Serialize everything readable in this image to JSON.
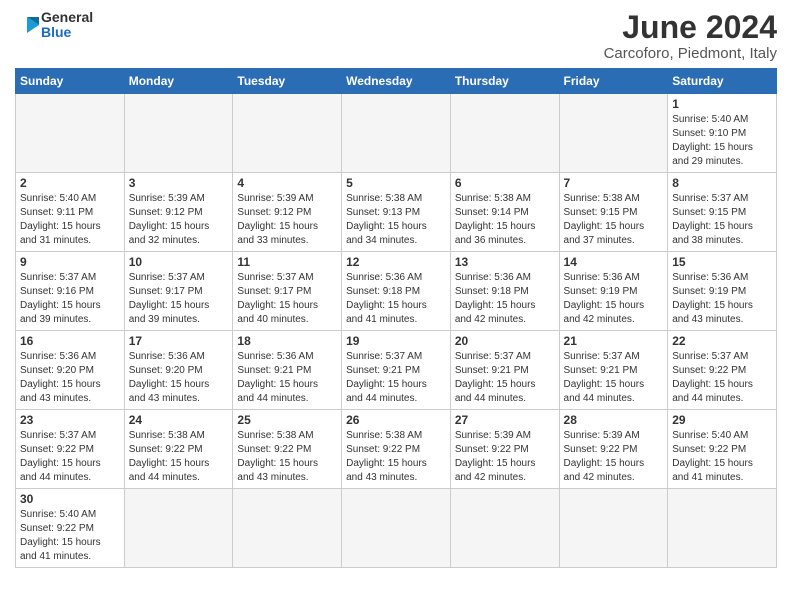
{
  "logo": {
    "line1": "General",
    "line2": "Blue"
  },
  "title": "June 2024",
  "location": "Carcoforo, Piedmont, Italy",
  "weekdays": [
    "Sunday",
    "Monday",
    "Tuesday",
    "Wednesday",
    "Thursday",
    "Friday",
    "Saturday"
  ],
  "weeks": [
    [
      {
        "day": "",
        "info": ""
      },
      {
        "day": "",
        "info": ""
      },
      {
        "day": "",
        "info": ""
      },
      {
        "day": "",
        "info": ""
      },
      {
        "day": "",
        "info": ""
      },
      {
        "day": "",
        "info": ""
      },
      {
        "day": "1",
        "info": "Sunrise: 5:40 AM\nSunset: 9:10 PM\nDaylight: 15 hours\nand 29 minutes."
      }
    ],
    [
      {
        "day": "2",
        "info": "Sunrise: 5:40 AM\nSunset: 9:11 PM\nDaylight: 15 hours\nand 31 minutes."
      },
      {
        "day": "3",
        "info": "Sunrise: 5:39 AM\nSunset: 9:12 PM\nDaylight: 15 hours\nand 32 minutes."
      },
      {
        "day": "4",
        "info": "Sunrise: 5:39 AM\nSunset: 9:12 PM\nDaylight: 15 hours\nand 33 minutes."
      },
      {
        "day": "5",
        "info": "Sunrise: 5:38 AM\nSunset: 9:13 PM\nDaylight: 15 hours\nand 34 minutes."
      },
      {
        "day": "6",
        "info": "Sunrise: 5:38 AM\nSunset: 9:14 PM\nDaylight: 15 hours\nand 36 minutes."
      },
      {
        "day": "7",
        "info": "Sunrise: 5:38 AM\nSunset: 9:15 PM\nDaylight: 15 hours\nand 37 minutes."
      },
      {
        "day": "8",
        "info": "Sunrise: 5:37 AM\nSunset: 9:15 PM\nDaylight: 15 hours\nand 38 minutes."
      }
    ],
    [
      {
        "day": "9",
        "info": "Sunrise: 5:37 AM\nSunset: 9:16 PM\nDaylight: 15 hours\nand 39 minutes."
      },
      {
        "day": "10",
        "info": "Sunrise: 5:37 AM\nSunset: 9:17 PM\nDaylight: 15 hours\nand 39 minutes."
      },
      {
        "day": "11",
        "info": "Sunrise: 5:37 AM\nSunset: 9:17 PM\nDaylight: 15 hours\nand 40 minutes."
      },
      {
        "day": "12",
        "info": "Sunrise: 5:36 AM\nSunset: 9:18 PM\nDaylight: 15 hours\nand 41 minutes."
      },
      {
        "day": "13",
        "info": "Sunrise: 5:36 AM\nSunset: 9:18 PM\nDaylight: 15 hours\nand 42 minutes."
      },
      {
        "day": "14",
        "info": "Sunrise: 5:36 AM\nSunset: 9:19 PM\nDaylight: 15 hours\nand 42 minutes."
      },
      {
        "day": "15",
        "info": "Sunrise: 5:36 AM\nSunset: 9:19 PM\nDaylight: 15 hours\nand 43 minutes."
      }
    ],
    [
      {
        "day": "16",
        "info": "Sunrise: 5:36 AM\nSunset: 9:20 PM\nDaylight: 15 hours\nand 43 minutes."
      },
      {
        "day": "17",
        "info": "Sunrise: 5:36 AM\nSunset: 9:20 PM\nDaylight: 15 hours\nand 43 minutes."
      },
      {
        "day": "18",
        "info": "Sunrise: 5:36 AM\nSunset: 9:21 PM\nDaylight: 15 hours\nand 44 minutes."
      },
      {
        "day": "19",
        "info": "Sunrise: 5:37 AM\nSunset: 9:21 PM\nDaylight: 15 hours\nand 44 minutes."
      },
      {
        "day": "20",
        "info": "Sunrise: 5:37 AM\nSunset: 9:21 PM\nDaylight: 15 hours\nand 44 minutes."
      },
      {
        "day": "21",
        "info": "Sunrise: 5:37 AM\nSunset: 9:21 PM\nDaylight: 15 hours\nand 44 minutes."
      },
      {
        "day": "22",
        "info": "Sunrise: 5:37 AM\nSunset: 9:22 PM\nDaylight: 15 hours\nand 44 minutes."
      }
    ],
    [
      {
        "day": "23",
        "info": "Sunrise: 5:37 AM\nSunset: 9:22 PM\nDaylight: 15 hours\nand 44 minutes."
      },
      {
        "day": "24",
        "info": "Sunrise: 5:38 AM\nSunset: 9:22 PM\nDaylight: 15 hours\nand 44 minutes."
      },
      {
        "day": "25",
        "info": "Sunrise: 5:38 AM\nSunset: 9:22 PM\nDaylight: 15 hours\nand 43 minutes."
      },
      {
        "day": "26",
        "info": "Sunrise: 5:38 AM\nSunset: 9:22 PM\nDaylight: 15 hours\nand 43 minutes."
      },
      {
        "day": "27",
        "info": "Sunrise: 5:39 AM\nSunset: 9:22 PM\nDaylight: 15 hours\nand 42 minutes."
      },
      {
        "day": "28",
        "info": "Sunrise: 5:39 AM\nSunset: 9:22 PM\nDaylight: 15 hours\nand 42 minutes."
      },
      {
        "day": "29",
        "info": "Sunrise: 5:40 AM\nSunset: 9:22 PM\nDaylight: 15 hours\nand 41 minutes."
      }
    ],
    [
      {
        "day": "30",
        "info": "Sunrise: 5:40 AM\nSunset: 9:22 PM\nDaylight: 15 hours\nand 41 minutes."
      },
      {
        "day": "",
        "info": ""
      },
      {
        "day": "",
        "info": ""
      },
      {
        "day": "",
        "info": ""
      },
      {
        "day": "",
        "info": ""
      },
      {
        "day": "",
        "info": ""
      },
      {
        "day": "",
        "info": ""
      }
    ]
  ]
}
